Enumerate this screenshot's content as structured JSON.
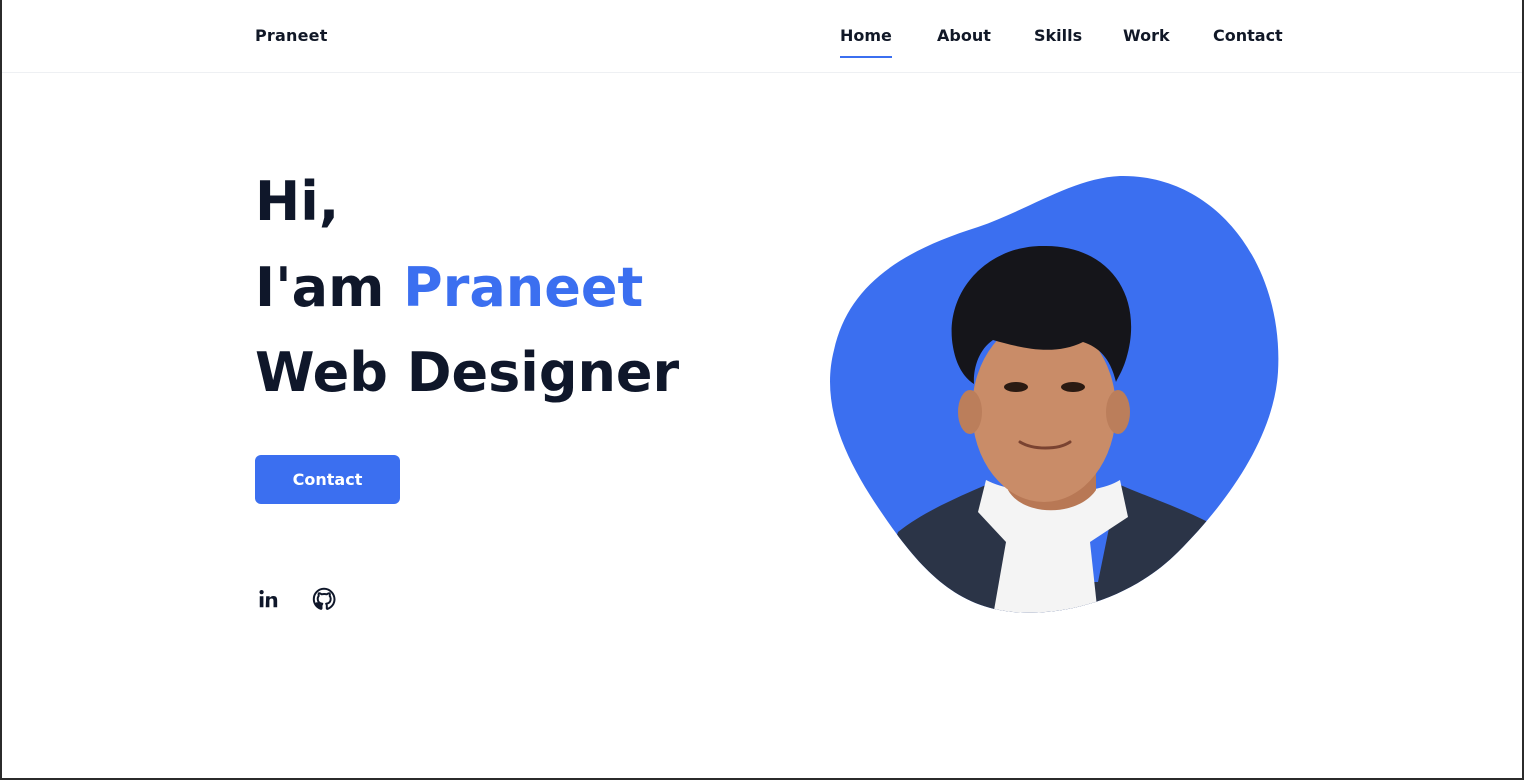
{
  "header": {
    "logo": "Praneet",
    "nav": [
      {
        "label": "Home",
        "active": true
      },
      {
        "label": "About",
        "active": false
      },
      {
        "label": "Skills",
        "active": false
      },
      {
        "label": "Work",
        "active": false
      },
      {
        "label": "Contact",
        "active": false
      }
    ]
  },
  "hero": {
    "greeting": "Hi,",
    "intro_prefix": "I'am ",
    "name": "Praneet",
    "role": "Web Designer",
    "cta_label": "Contact"
  },
  "social": [
    {
      "icon": "linkedin-icon"
    },
    {
      "icon": "github-icon"
    }
  ],
  "colors": {
    "accent": "#3b6ff0",
    "text": "#0f172a",
    "background": "#ffffff"
  }
}
